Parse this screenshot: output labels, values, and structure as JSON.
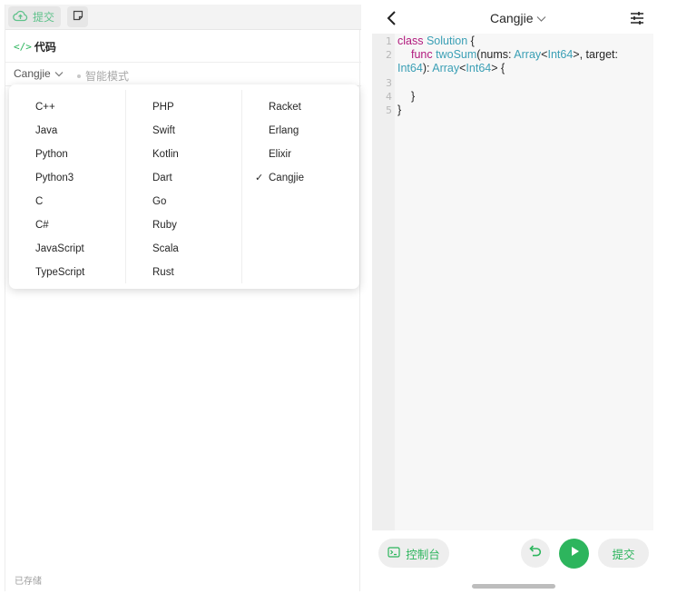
{
  "left": {
    "toolbar": {
      "submit_label": "提交"
    },
    "code_tab": {
      "glyph": "</>",
      "label": "代码"
    },
    "lang_select": {
      "value": "Cangjie"
    },
    "mode_hint": "智能模式",
    "dropdown": {
      "selected": "Cangjie",
      "columns": [
        [
          "C++",
          "Java",
          "Python",
          "Python3",
          "C",
          "C#",
          "JavaScript",
          "TypeScript"
        ],
        [
          "PHP",
          "Swift",
          "Kotlin",
          "Dart",
          "Go",
          "Ruby",
          "Scala",
          "Rust"
        ],
        [
          "Racket",
          "Erlang",
          "Elixir",
          "Cangjie"
        ]
      ]
    },
    "status": "已存储"
  },
  "right": {
    "header": {
      "title": "Cangjie"
    },
    "editor": {
      "line_numbers": [
        "1",
        "2",
        "3",
        "4",
        "5"
      ],
      "code": {
        "l1_kw": "class",
        "l1_type": "Solution",
        "l1_rest": " {",
        "l2_kw": "func",
        "l2_fn": "twoSum",
        "l2_a": "(nums: ",
        "l2_t1": "Array",
        "l2_b": "<",
        "l2_t2": "Int64",
        "l2_c": ">, target:",
        "l2w_t1": "Int64",
        "l2w_a": "): ",
        "l2w_t2": "Array",
        "l2w_b": "<",
        "l2w_t3": "Int64",
        "l2w_c": "> {",
        "l4": "}",
        "l5": "}"
      }
    },
    "bottom": {
      "console_label": "控制台",
      "submit_label": "提交"
    }
  },
  "colors": {
    "accent_green": "#2db55d",
    "keyword": "#b11a7d",
    "type": "#3a9fb5"
  }
}
